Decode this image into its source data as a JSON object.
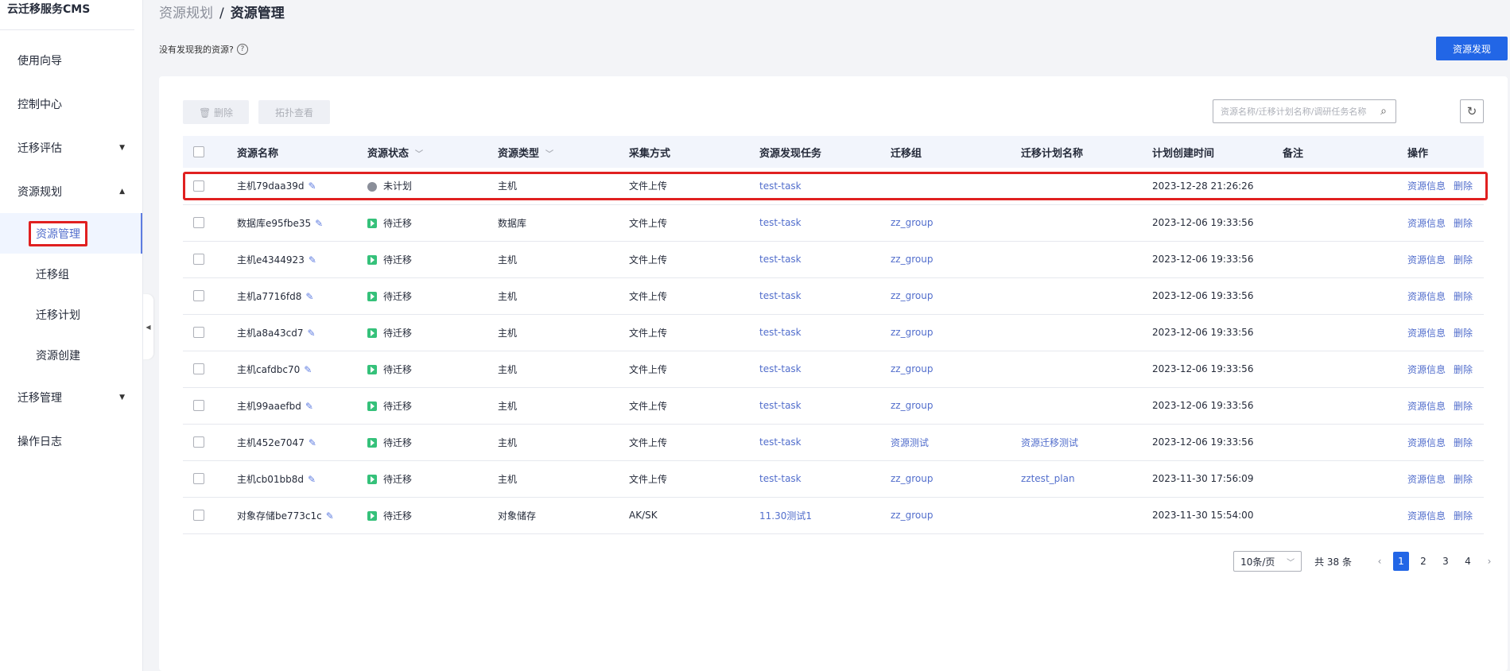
{
  "app": {
    "title": "云迁移服务CMS"
  },
  "sidebar": {
    "items": [
      {
        "label": "使用向导"
      },
      {
        "label": "控制中心"
      },
      {
        "label": "迁移评估",
        "caret": "▼"
      },
      {
        "label": "资源规划",
        "caret": "▲"
      },
      {
        "label": "资源管理"
      },
      {
        "label": "迁移组"
      },
      {
        "label": "迁移计划"
      },
      {
        "label": "资源创建"
      },
      {
        "label": "迁移管理",
        "caret": "▼"
      },
      {
        "label": "操作日志"
      }
    ]
  },
  "breadcrumb": {
    "parent": "资源规划",
    "separator": "/",
    "current": "资源管理"
  },
  "notice": {
    "text": "没有发现我的资源?",
    "help_icon": "?"
  },
  "actions": {
    "discover": "资源发现"
  },
  "toolbar": {
    "delete_label": "删除",
    "delete_icon": "🗑",
    "topology_label": "拓扑查看",
    "search_placeholder": "资源名称/迁移计划名称/调研任务名称",
    "search_icon": "⌕",
    "refresh_icon": "↻"
  },
  "table": {
    "headers": {
      "name": "资源名称",
      "status": "资源状态",
      "type": "资源类型",
      "collect": "采集方式",
      "task": "资源发现任务",
      "group": "迁移组",
      "plan": "迁移计划名称",
      "created": "计划创建时间",
      "remark": "备注",
      "ops": "操作"
    },
    "sort_caret": "﹀",
    "edit_icon": "✎",
    "op_info": "资源信息",
    "op_delete": "删除",
    "rows": [
      {
        "name": "主机79daa39d",
        "status": "未计划",
        "status_kind": "gray",
        "type": "主机",
        "collect": "文件上传",
        "task": "test-task",
        "group": "",
        "plan": "",
        "created": "2023-12-28 21:26:26"
      },
      {
        "name": "数据库e95fbe35",
        "status": "待迁移",
        "status_kind": "green",
        "type": "数据库",
        "collect": "文件上传",
        "task": "test-task",
        "group": "zz_group",
        "plan": "",
        "created": "2023-12-06 19:33:56"
      },
      {
        "name": "主机e4344923",
        "status": "待迁移",
        "status_kind": "green",
        "type": "主机",
        "collect": "文件上传",
        "task": "test-task",
        "group": "zz_group",
        "plan": "",
        "created": "2023-12-06 19:33:56"
      },
      {
        "name": "主机a7716fd8",
        "status": "待迁移",
        "status_kind": "green",
        "type": "主机",
        "collect": "文件上传",
        "task": "test-task",
        "group": "zz_group",
        "plan": "",
        "created": "2023-12-06 19:33:56"
      },
      {
        "name": "主机a8a43cd7",
        "status": "待迁移",
        "status_kind": "green",
        "type": "主机",
        "collect": "文件上传",
        "task": "test-task",
        "group": "zz_group",
        "plan": "",
        "created": "2023-12-06 19:33:56"
      },
      {
        "name": "主机cafdbc70",
        "status": "待迁移",
        "status_kind": "green",
        "type": "主机",
        "collect": "文件上传",
        "task": "test-task",
        "group": "zz_group",
        "plan": "",
        "created": "2023-12-06 19:33:56"
      },
      {
        "name": "主机99aaefbd",
        "status": "待迁移",
        "status_kind": "green",
        "type": "主机",
        "collect": "文件上传",
        "task": "test-task",
        "group": "zz_group",
        "plan": "",
        "created": "2023-12-06 19:33:56"
      },
      {
        "name": "主机452e7047",
        "status": "待迁移",
        "status_kind": "green",
        "type": "主机",
        "collect": "文件上传",
        "task": "test-task",
        "group": "资源测试",
        "plan": "资源迁移测试",
        "created": "2023-12-06 19:33:56"
      },
      {
        "name": "主机cb01bb8d",
        "status": "待迁移",
        "status_kind": "green",
        "type": "主机",
        "collect": "文件上传",
        "task": "test-task",
        "group": "zz_group",
        "plan": "zztest_plan",
        "created": "2023-11-30 17:56:09"
      },
      {
        "name": "对象存储be773c1c",
        "status": "待迁移",
        "status_kind": "green",
        "type": "对象储存",
        "collect": "AK/SK",
        "task": "11.30测试1",
        "group": "zz_group",
        "plan": "",
        "created": "2023-11-30 15:54:00"
      }
    ]
  },
  "pagination": {
    "page_size": "10条/页",
    "total": "共 38 条",
    "pages": [
      "1",
      "2",
      "3",
      "4"
    ],
    "current": "1",
    "prev": "‹",
    "next": "›",
    "dropdown_icon": "﹀"
  },
  "colors": {
    "accent": "#2266e6",
    "link": "#526ecc",
    "highlight": "#e02020",
    "ready": "#35c17a"
  }
}
